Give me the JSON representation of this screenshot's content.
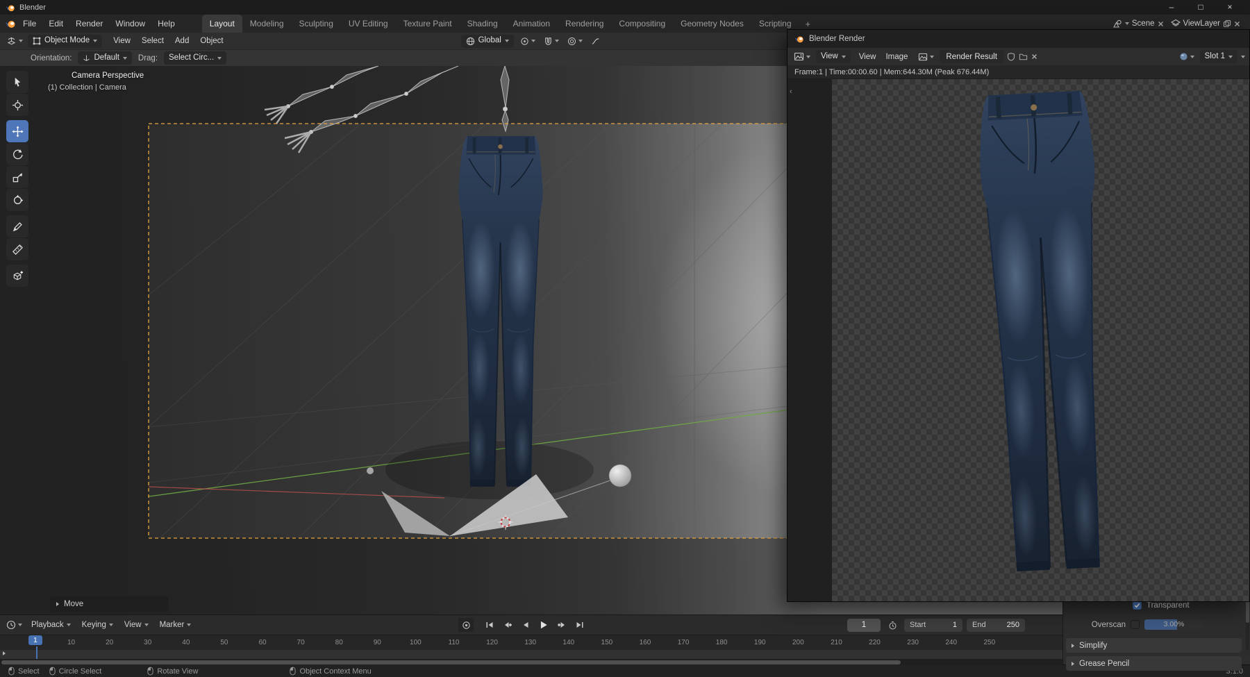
{
  "titlebar": {
    "title": "Blender",
    "minimize": "–",
    "maximize": "□",
    "close": "×"
  },
  "menubar": {
    "menus": [
      {
        "label": "File"
      },
      {
        "label": "Edit"
      },
      {
        "label": "Render"
      },
      {
        "label": "Window"
      },
      {
        "label": "Help"
      }
    ],
    "tabs": [
      {
        "label": "Layout",
        "active": true
      },
      {
        "label": "Modeling"
      },
      {
        "label": "Sculpting"
      },
      {
        "label": "UV Editing"
      },
      {
        "label": "Texture Paint"
      },
      {
        "label": "Shading"
      },
      {
        "label": "Animation"
      },
      {
        "label": "Rendering"
      },
      {
        "label": "Compositing"
      },
      {
        "label": "Geometry Nodes"
      },
      {
        "label": "Scripting"
      }
    ],
    "add_tab": "+",
    "scene_value": "Scene",
    "view_layer_value": "ViewLayer"
  },
  "viewport_header": {
    "mode": "Object Mode",
    "menus": [
      {
        "label": "View"
      },
      {
        "label": "Select"
      },
      {
        "label": "Add"
      },
      {
        "label": "Object"
      }
    ],
    "orientation": "Global"
  },
  "tool_settings": {
    "orientation_label": "Orientation:",
    "orientation_value": "Default",
    "drag_label": "Drag:",
    "drag_value": "Select Circ..."
  },
  "viewport": {
    "overlay_title": "Camera Perspective",
    "overlay_subtitle": "(1) Collection | Camera",
    "operator_panel": "Move",
    "active_tool": "move",
    "tools": [
      "tweak",
      "cursor",
      "move",
      "rotate",
      "scale",
      "transform",
      "annotate",
      "measure",
      "add-cube"
    ]
  },
  "render_window": {
    "title": "Blender Render",
    "mode": "View",
    "menus": [
      {
        "label": "View"
      },
      {
        "label": "Image"
      }
    ],
    "image_name": "Render Result",
    "slot": "Slot 1",
    "stats": "Frame:1 | Time:00:00.60 | Mem:644.30M (Peak 676.44M)"
  },
  "timeline": {
    "menus": [
      {
        "label": "Playback",
        "chevron": " "
      },
      {
        "label": "Keying",
        "chevron": " "
      },
      {
        "label": "View"
      },
      {
        "label": "Marker"
      }
    ],
    "current_frame": "1",
    "playhead_frame": "1",
    "start_label": "Start",
    "start_value": "1",
    "end_label": "End",
    "end_value": "250",
    "ticks": [
      "10",
      "20",
      "30",
      "40",
      "50",
      "60",
      "70",
      "80",
      "90",
      "100",
      "110",
      "120",
      "130",
      "140",
      "150",
      "160",
      "170",
      "180",
      "190",
      "200",
      "210",
      "220",
      "230",
      "240",
      "250"
    ]
  },
  "properties": {
    "transparent_label": "Transparent",
    "overscan_label": "Overscan",
    "overscan_value": "3.00%",
    "simplify_label": "Simplify",
    "grease_pencil_label": "Grease Pencil"
  },
  "statusbar": {
    "items": [
      {
        "label": "Select"
      },
      {
        "label": "Circle Select"
      },
      {
        "label": "Rotate View"
      },
      {
        "label": "Object Context Menu"
      }
    ],
    "version": "3.1.0"
  },
  "colors": {
    "accent_blue": "#4772b3",
    "camera_border": "#e8a33d",
    "axis_green": "#6faa45",
    "axis_red": "#c14f4f",
    "denim": "#27374e"
  }
}
